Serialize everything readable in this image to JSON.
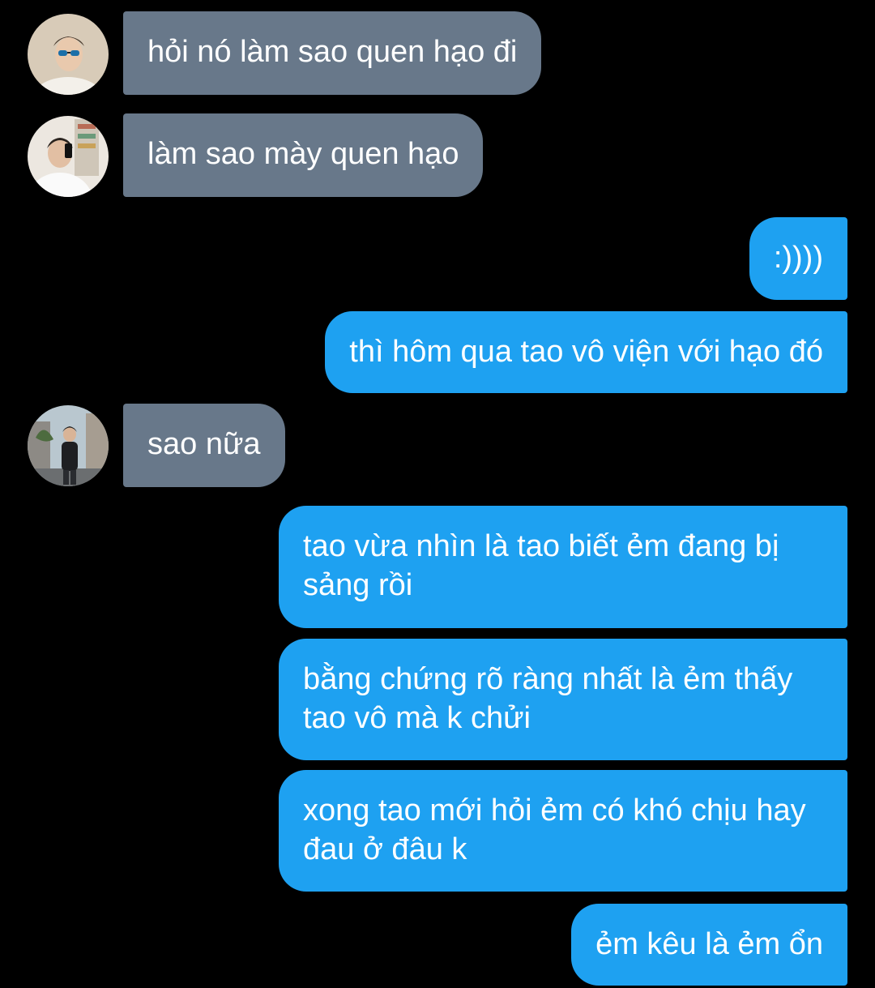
{
  "colors": {
    "background": "#000000",
    "incoming_bubble": "#68788a",
    "outgoing_bubble": "#1ea1f1",
    "text": "#ffffff"
  },
  "messages": [
    {
      "from": "contact-1",
      "direction": "incoming",
      "text": "hỏi nó làm sao quen hạo đi"
    },
    {
      "from": "contact-2",
      "direction": "incoming",
      "text": "làm sao mày quen hạo"
    },
    {
      "from": "me",
      "direction": "outgoing",
      "text": ":))))"
    },
    {
      "from": "me",
      "direction": "outgoing",
      "text": "thì hôm qua tao vô viện với hạo đó"
    },
    {
      "from": "contact-3",
      "direction": "incoming",
      "text": "sao nữa"
    },
    {
      "from": "me",
      "direction": "outgoing",
      "text": "tao vừa nhìn là tao biết ẻm đang bị sảng rồi"
    },
    {
      "from": "me",
      "direction": "outgoing",
      "text": "bằng chứng rõ ràng nhất là ẻm thấy tao vô mà k chửi"
    },
    {
      "from": "me",
      "direction": "outgoing",
      "text": "xong tao mới hỏi ẻm có khó chịu hay đau ở đâu k"
    },
    {
      "from": "me",
      "direction": "outgoing",
      "text": "ẻm kêu là ẻm ổn"
    }
  ],
  "avatars": [
    {
      "icon": "avatar-photo-sunglasses"
    },
    {
      "icon": "avatar-photo-mirror-selfie"
    },
    {
      "icon": "avatar-photo-street"
    }
  ]
}
